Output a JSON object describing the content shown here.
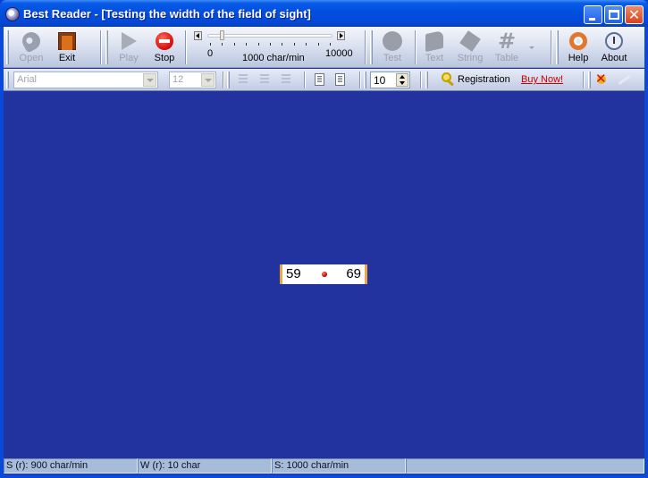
{
  "window": {
    "title": "Best Reader - [Testing the width of the field of sight]",
    "controls": {
      "minimize": "minimize",
      "maximize": "maximize",
      "close": "close"
    }
  },
  "toolbar": {
    "open_label": "Open",
    "exit_label": "Exit",
    "play_label": "Play",
    "stop_label": "Stop",
    "test_label": "Test",
    "text_label": "Text",
    "string_label": "String",
    "table_label": "Table",
    "help_label": "Help",
    "about_label": "About"
  },
  "speed_slider": {
    "min_label": "0",
    "max_label": "10000",
    "value_label": "1000 char/min",
    "min": 0,
    "max": 10000,
    "value": 1000
  },
  "format_bar": {
    "font_value": "Arial",
    "font_size_value": "12",
    "width_value": "10",
    "registration_label": "Registration",
    "buy_now_label": "Buy Now!"
  },
  "sight_test": {
    "left_number": "59",
    "right_number": "69"
  },
  "statusbar": {
    "reading_speed": "S (r): 900 char/min",
    "width": "W (r): 10 char",
    "speed": "S: 1000 char/min",
    "extra": ""
  },
  "colors": {
    "canvas_background": "#2233a0",
    "buy_now_link": "#cc0000",
    "sight_box_border": "#e8a848",
    "fixation_dot": "#cc0000"
  }
}
